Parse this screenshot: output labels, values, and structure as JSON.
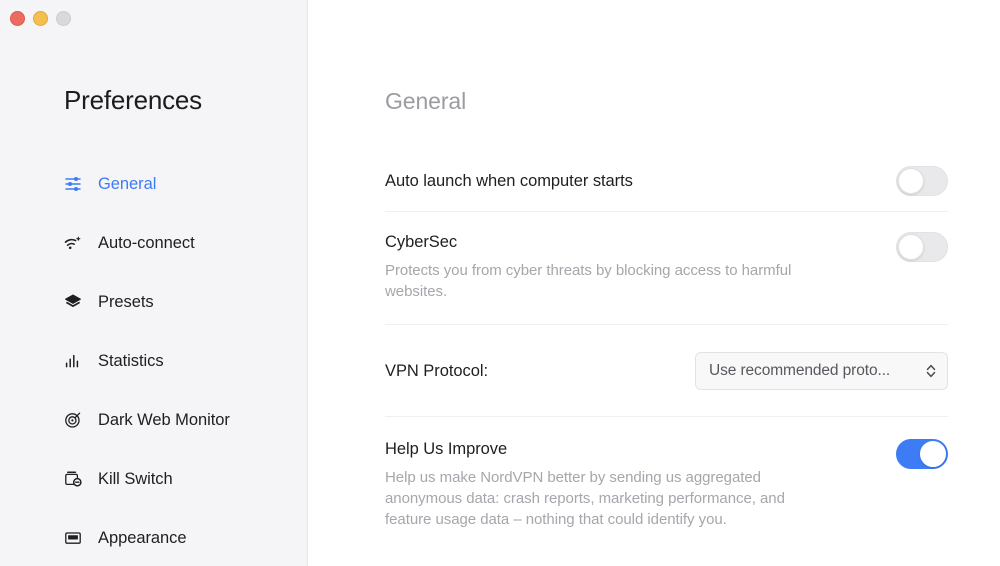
{
  "window": {
    "traffic_lights": [
      {
        "name": "close",
        "color": "#ec6a5f"
      },
      {
        "name": "minimize",
        "color": "#f4bf4f"
      },
      {
        "name": "zoom",
        "color": "#d9d9dc"
      }
    ]
  },
  "sidebar": {
    "title": "Preferences",
    "active_color": "#3d7cf4",
    "items": [
      {
        "label": "General",
        "icon": "sliders-icon",
        "active": true
      },
      {
        "label": "Auto-connect",
        "icon": "wifi-sparkle-icon",
        "active": false
      },
      {
        "label": "Presets",
        "icon": "layers-icon",
        "active": false
      },
      {
        "label": "Statistics",
        "icon": "bar-chart-icon",
        "active": false
      },
      {
        "label": "Dark Web Monitor",
        "icon": "target-icon",
        "active": false
      },
      {
        "label": "Kill Switch",
        "icon": "kill-switch-icon",
        "active": false
      },
      {
        "label": "Appearance",
        "icon": "display-icon",
        "active": false
      }
    ]
  },
  "main": {
    "title": "General",
    "rows": [
      {
        "key": "auto_launch",
        "title": "Auto launch when computer starts",
        "description": "",
        "control": "toggle",
        "value": "off"
      },
      {
        "key": "cybersec",
        "title": "CyberSec",
        "description": "Protects you from cyber threats by blocking access to harmful websites.",
        "control": "toggle",
        "value": "off"
      },
      {
        "key": "vpn_protocol",
        "title": "VPN Protocol:",
        "description": "",
        "control": "select",
        "value": "Use recommended proto...",
        "options": [
          "Use recommended protocol"
        ]
      },
      {
        "key": "help_us_improve",
        "title": "Help Us Improve",
        "description": "Help us make NordVPN better by sending us aggregated anonymous data: crash reports, marketing performance, and feature usage data – nothing that could identify you.",
        "control": "toggle",
        "value": "on"
      }
    ]
  }
}
